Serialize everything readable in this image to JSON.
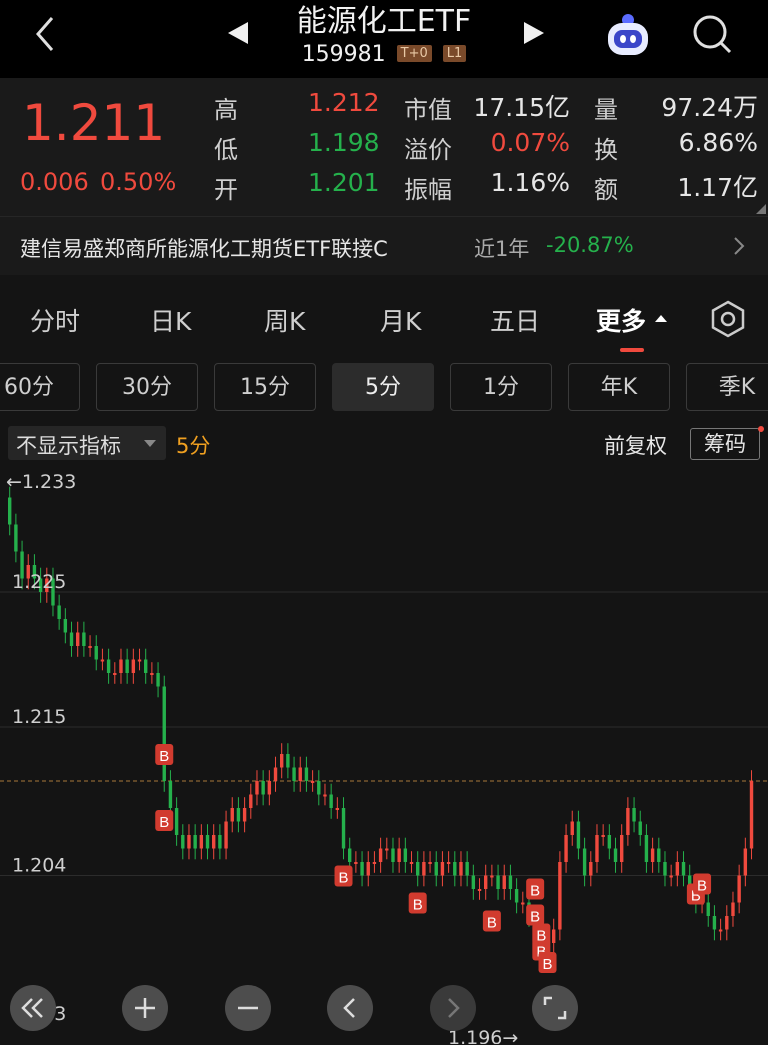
{
  "header": {
    "title": "能源化工ETF",
    "code": "159981",
    "tags": [
      "T+0",
      "L1"
    ]
  },
  "quote": {
    "price": "1.211",
    "change": "0.006",
    "change_pct": "0.50%",
    "stats": [
      {
        "label": "高",
        "value": "1.212",
        "color": "red"
      },
      {
        "label": "低",
        "value": "1.198",
        "color": "green"
      },
      {
        "label": "开",
        "value": "1.201",
        "color": "green"
      },
      {
        "label": "市值",
        "value": "17.15亿",
        "color": "white"
      },
      {
        "label": "溢价",
        "value": "0.07%",
        "color": "red"
      },
      {
        "label": "振幅",
        "value": "1.16%",
        "color": "white"
      },
      {
        "label": "量",
        "value": "97.24万",
        "color": "white"
      },
      {
        "label": "换",
        "value": "6.86%",
        "color": "white"
      },
      {
        "label": "额",
        "value": "1.17亿",
        "color": "white"
      }
    ]
  },
  "banner": {
    "name": "建信易盛郑商所能源化工期货ETF联接C",
    "period": "近1年",
    "return": "-20.87%"
  },
  "tabs": [
    "分时",
    "日K",
    "周K",
    "月K",
    "五日",
    "更多"
  ],
  "intervals": [
    "60分",
    "30分",
    "15分",
    "5分",
    "1分",
    "年K",
    "季K"
  ],
  "selected_interval": "5分",
  "indicator": {
    "dropdown": "不显示指标",
    "period": "5分",
    "adjust": "前复权",
    "chips": "筹码"
  },
  "chart_data": {
    "type": "candlestick",
    "y_ticks": [
      "1.233",
      "1.225",
      "1.215",
      "1.204",
      "1.193"
    ],
    "max_label": "←1.233",
    "min_label": "1.196→",
    "reference_price": 1.211,
    "colors": {
      "up": "#f04a3e",
      "down": "#25b14c"
    },
    "marker_label": "B",
    "closes": [
      1.23,
      1.228,
      1.226,
      1.227,
      1.226,
      1.225,
      1.226,
      1.224,
      1.223,
      1.222,
      1.221,
      1.222,
      1.221,
      1.221,
      1.22,
      1.22,
      1.219,
      1.219,
      1.22,
      1.219,
      1.22,
      1.22,
      1.219,
      1.219,
      1.218,
      1.211,
      1.209,
      1.207,
      1.206,
      1.207,
      1.206,
      1.207,
      1.206,
      1.207,
      1.206,
      1.208,
      1.209,
      1.208,
      1.209,
      1.21,
      1.211,
      1.21,
      1.211,
      1.212,
      1.213,
      1.212,
      1.211,
      1.212,
      1.211,
      1.211,
      1.21,
      1.21,
      1.209,
      1.209,
      1.206,
      1.205,
      1.205,
      1.204,
      1.205,
      1.205,
      1.206,
      1.206,
      1.205,
      1.206,
      1.205,
      1.205,
      1.204,
      1.205,
      1.205,
      1.204,
      1.205,
      1.205,
      1.204,
      1.205,
      1.204,
      1.203,
      1.203,
      1.204,
      1.204,
      1.203,
      1.204,
      1.203,
      1.202,
      1.202,
      1.201,
      1.2,
      1.198,
      1.199,
      1.2,
      1.205,
      1.207,
      1.208,
      1.206,
      1.204,
      1.205,
      1.207,
      1.207,
      1.206,
      1.205,
      1.207,
      1.209,
      1.208,
      1.207,
      1.205,
      1.206,
      1.205,
      1.204,
      1.204,
      1.205,
      1.204,
      1.203,
      1.202,
      1.202,
      1.201,
      1.2,
      1.2,
      1.201,
      1.202,
      1.204,
      1.206,
      1.211
    ]
  }
}
